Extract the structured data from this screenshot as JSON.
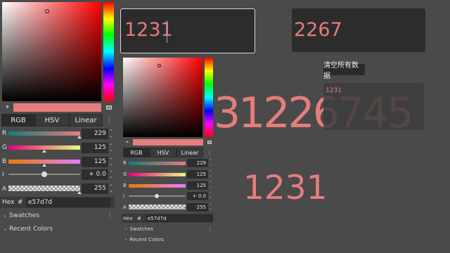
{
  "color": {
    "hex": "#e57d7d"
  },
  "picker_large": {
    "tabs": [
      "RGB",
      "HSV",
      "Linear"
    ],
    "channels": [
      {
        "label": "R",
        "value": "229"
      },
      {
        "label": "G",
        "value": "125"
      },
      {
        "label": "B",
        "value": "125"
      },
      {
        "label": "I",
        "value": "+ 0.0"
      },
      {
        "label": "A",
        "value": "255"
      }
    ],
    "hex_label": "Hex",
    "hash": "#",
    "hex_value": "e57d7d",
    "swatches_label": "Swatches",
    "recent_label": "Recent Colors"
  },
  "picker_small": {
    "tabs": [
      "RGB",
      "HSV",
      "Linear"
    ],
    "channels": [
      {
        "label": "R",
        "value": "229"
      },
      {
        "label": "G",
        "value": "125"
      },
      {
        "label": "B",
        "value": "125"
      },
      {
        "label": "I",
        "value": "+ 0.0"
      },
      {
        "label": "A",
        "value": "255"
      }
    ],
    "hex_label": "Hex",
    "hash": "#",
    "hex_value": "e57d7d",
    "swatches_label": "Swatches",
    "recent_label": "Recent Colors"
  },
  "input1": {
    "value": "1231"
  },
  "input2": {
    "value": "2267"
  },
  "clear_tooltip": "清空所有数据",
  "panel_text": "1231",
  "big_label_1": "31226745",
  "big_label_2": "1231"
}
